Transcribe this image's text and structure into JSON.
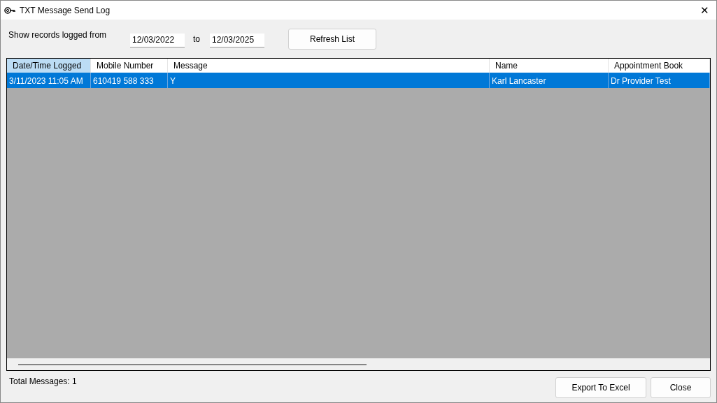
{
  "window": {
    "title": "TXT Message Send Log",
    "close": "✕"
  },
  "filter": {
    "label": "Show records logged from",
    "from": "12/03/2022",
    "to_label": "to",
    "to": "12/03/2025",
    "refresh": "Refresh List"
  },
  "table": {
    "columns": [
      {
        "label": "Date/Time Logged",
        "highlighted": true
      },
      {
        "label": "Mobile Number",
        "highlighted": false
      },
      {
        "label": "Message",
        "highlighted": false
      },
      {
        "label": "Name",
        "highlighted": false
      },
      {
        "label": "Appointment Book",
        "highlighted": false
      }
    ],
    "rows": [
      {
        "cells": [
          "3/11/2023 11:05 AM",
          "610419 588 333",
          "Y",
          "Karl Lancaster",
          "Dr Provider Test"
        ],
        "selected": true
      }
    ]
  },
  "status": "Total Messages: 1",
  "buttons": [
    "Export To Excel",
    "Close"
  ]
}
